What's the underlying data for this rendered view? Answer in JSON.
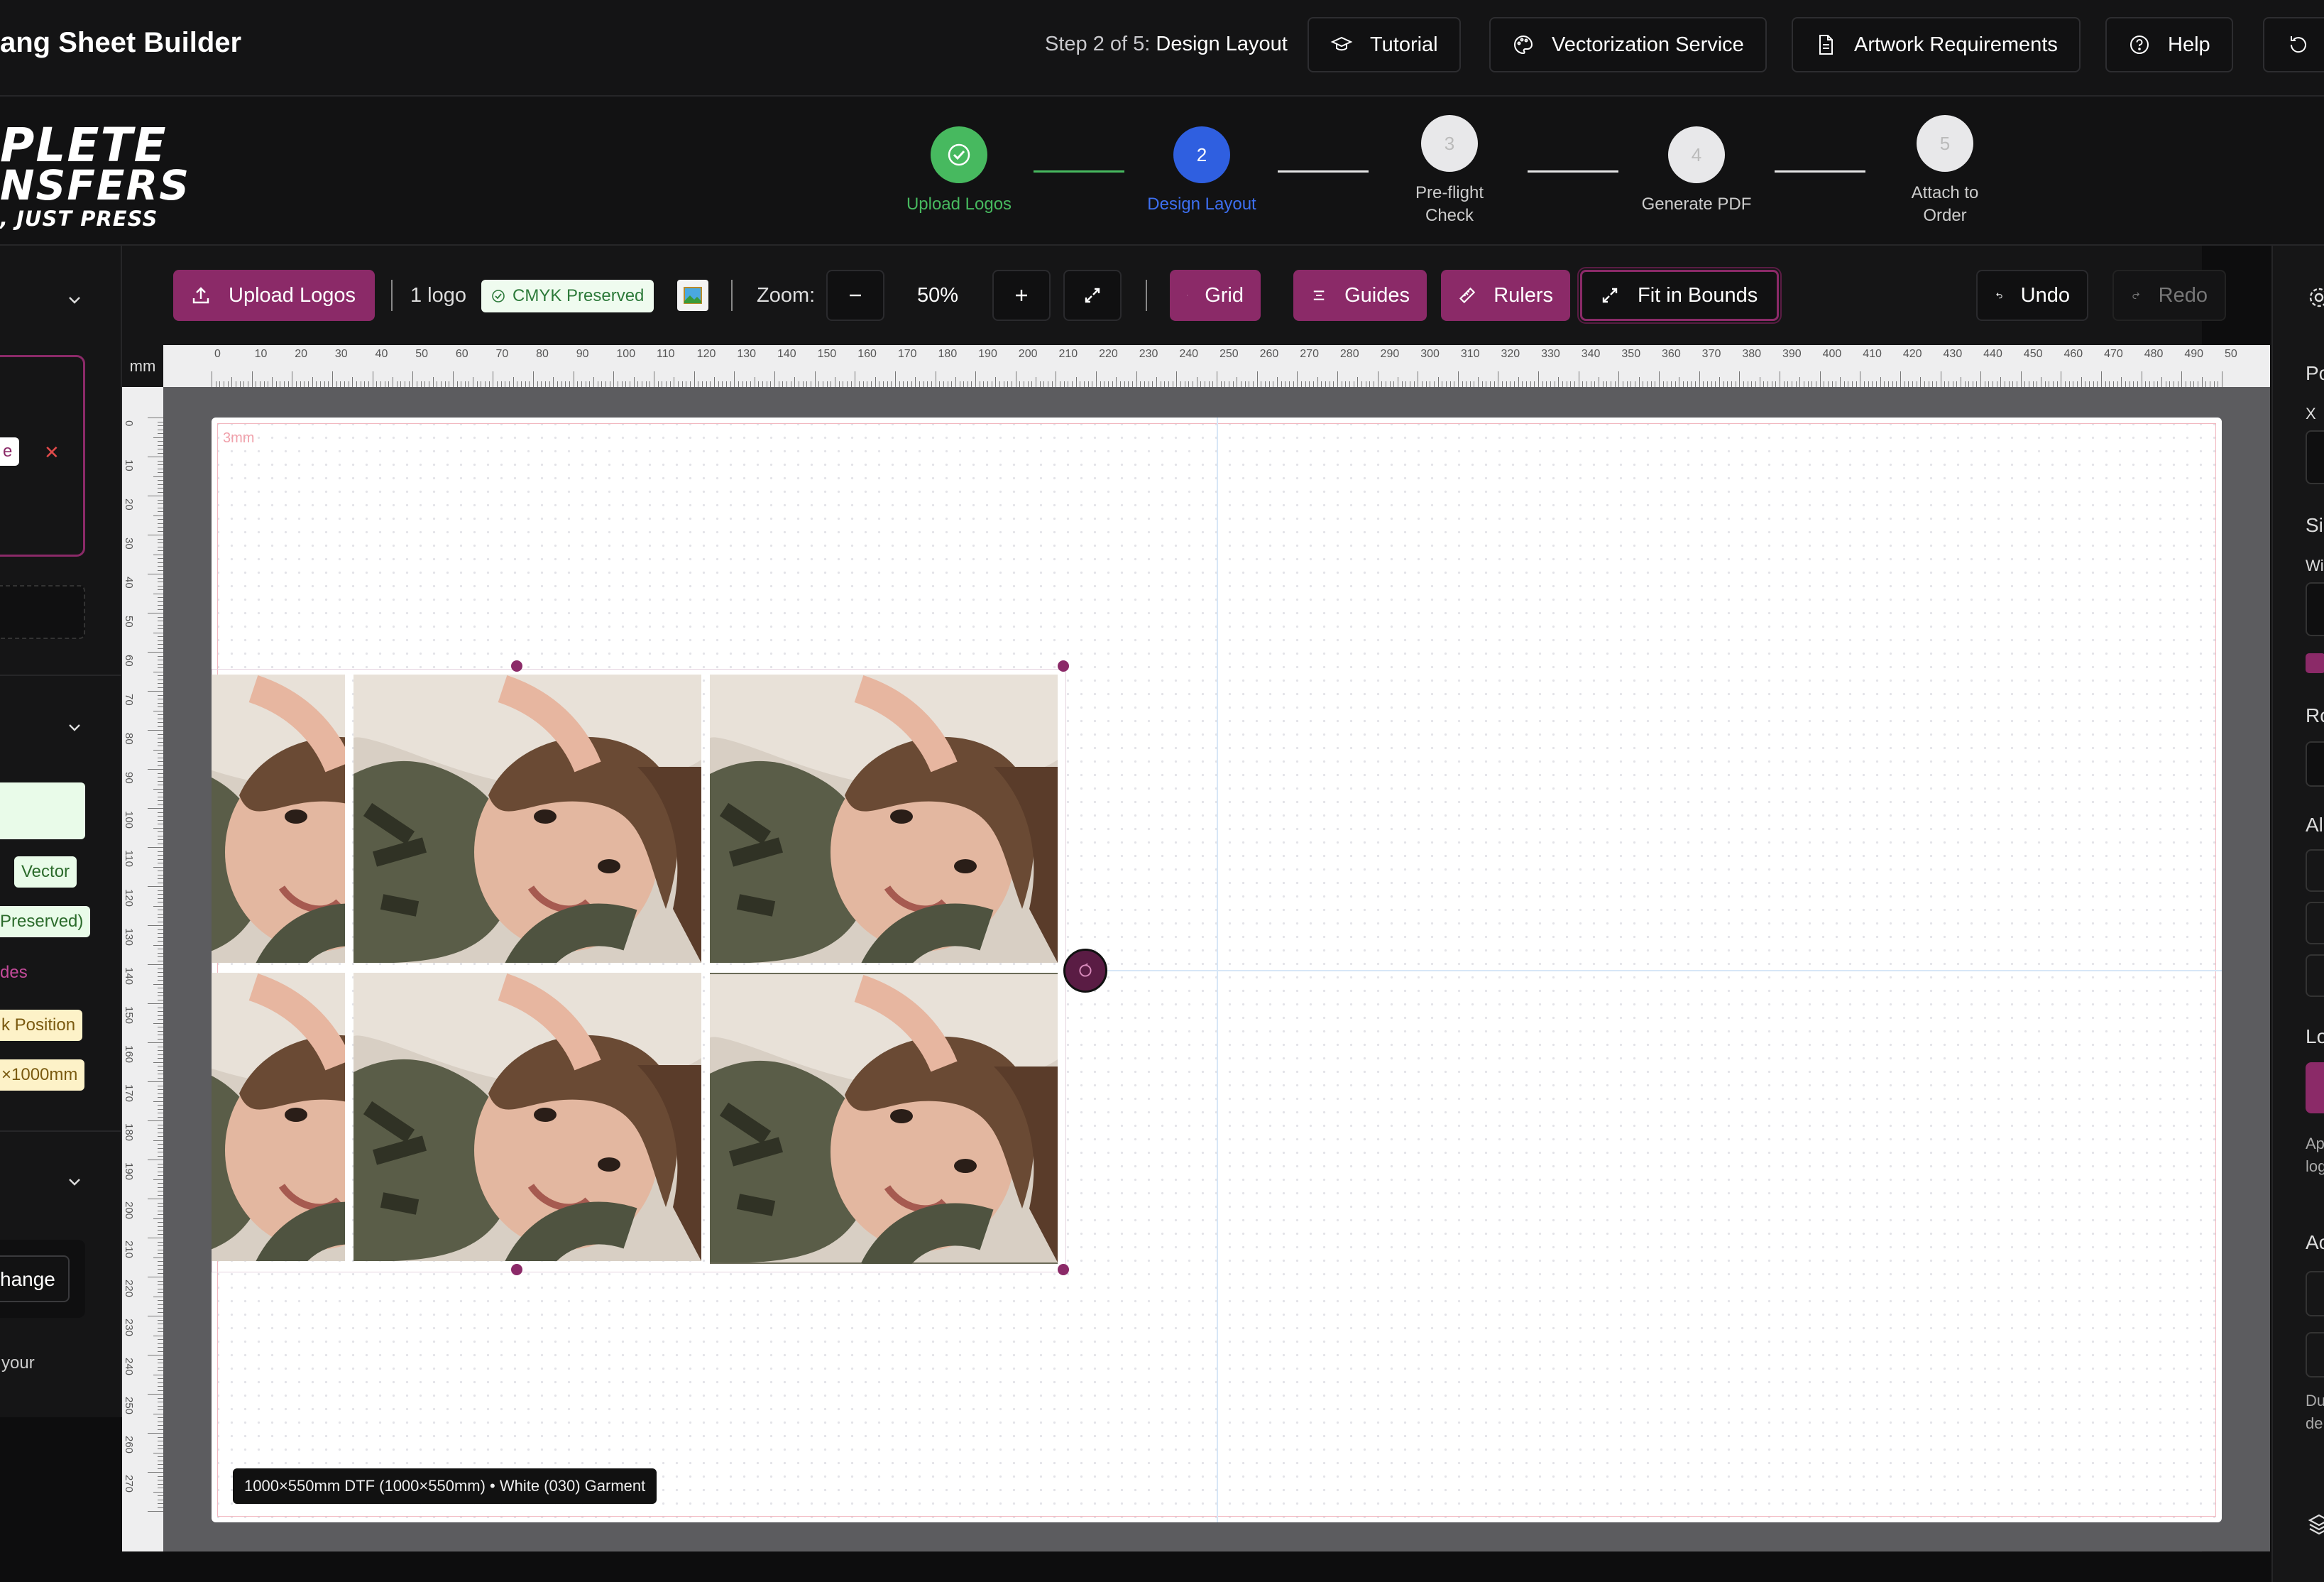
{
  "app": {
    "title": "ang Sheet Builder",
    "step_prefix": "Step 2 of 5:",
    "step_current": "Design Layout"
  },
  "top_buttons": {
    "tutorial": "Tutorial",
    "vectorization": "Vectorization Service",
    "artwork": "Artwork Requirements",
    "help": "Help"
  },
  "logo": {
    "line1": "PLETE",
    "line2": "NSFERS",
    "line3": ", JUST PRESS"
  },
  "steps": [
    {
      "num": "✓",
      "label": "Upload Logos",
      "state": "done"
    },
    {
      "num": "2",
      "label": "Design Layout",
      "state": "active"
    },
    {
      "num": "3",
      "label": "Pre-flight Check",
      "state": "todo"
    },
    {
      "num": "4",
      "label": "Generate PDF",
      "state": "todo"
    },
    {
      "num": "5",
      "label": "Attach to Order",
      "state": "todo"
    }
  ],
  "toolbar": {
    "upload": "Upload Logos",
    "logo_count": "1 logo",
    "cmyk": "CMYK Preserved",
    "zoom_label": "Zoom:",
    "zoom_value": "50%",
    "grid": "Grid",
    "guides": "Guides",
    "rulers": "Rulers",
    "fit": "Fit in Bounds",
    "undo": "Undo",
    "redo": "Redo"
  },
  "ruler": {
    "unit": "mm",
    "h_ticks": [
      "0",
      "10",
      "20",
      "30",
      "40",
      "50",
      "60",
      "70",
      "80",
      "90",
      "100",
      "110",
      "120",
      "130",
      "140",
      "150",
      "160",
      "170",
      "180",
      "190",
      "200",
      "210",
      "220",
      "230",
      "240",
      "250",
      "260",
      "270",
      "280",
      "290",
      "300",
      "310",
      "320",
      "330",
      "340",
      "350",
      "360",
      "370",
      "380",
      "390",
      "400",
      "410",
      "420",
      "430",
      "440",
      "450",
      "460",
      "470",
      "480",
      "490",
      "50"
    ],
    "v_ticks": [
      "0",
      "10",
      "20",
      "30",
      "40",
      "50",
      "60",
      "70",
      "80",
      "90",
      "100",
      "110",
      "120",
      "130",
      "140",
      "150",
      "160",
      "170",
      "180",
      "190",
      "200",
      "210",
      "220",
      "230",
      "240",
      "250",
      "260",
      "270"
    ]
  },
  "canvas": {
    "bleed_label": "3mm",
    "info": "1000×550mm DTF (1000×550mm) • White (030) Garment"
  },
  "left_panel": {
    "chip_e": "e",
    "vector": "Vector",
    "preserved": "Preserved)",
    "des": "des",
    "k_position": "k Position",
    "size": "×1000mm",
    "change": "hange",
    "your": "your"
  },
  "right_panel": {
    "labels": [
      "Po",
      "X",
      "Si",
      "Wi",
      "Ro",
      "Al",
      "Lo",
      "Ap",
      "log",
      "Ac",
      "Du",
      "de"
    ]
  },
  "colors": {
    "accent": "#8b2a68",
    "done": "#47b95f",
    "active": "#2f5fe0"
  }
}
